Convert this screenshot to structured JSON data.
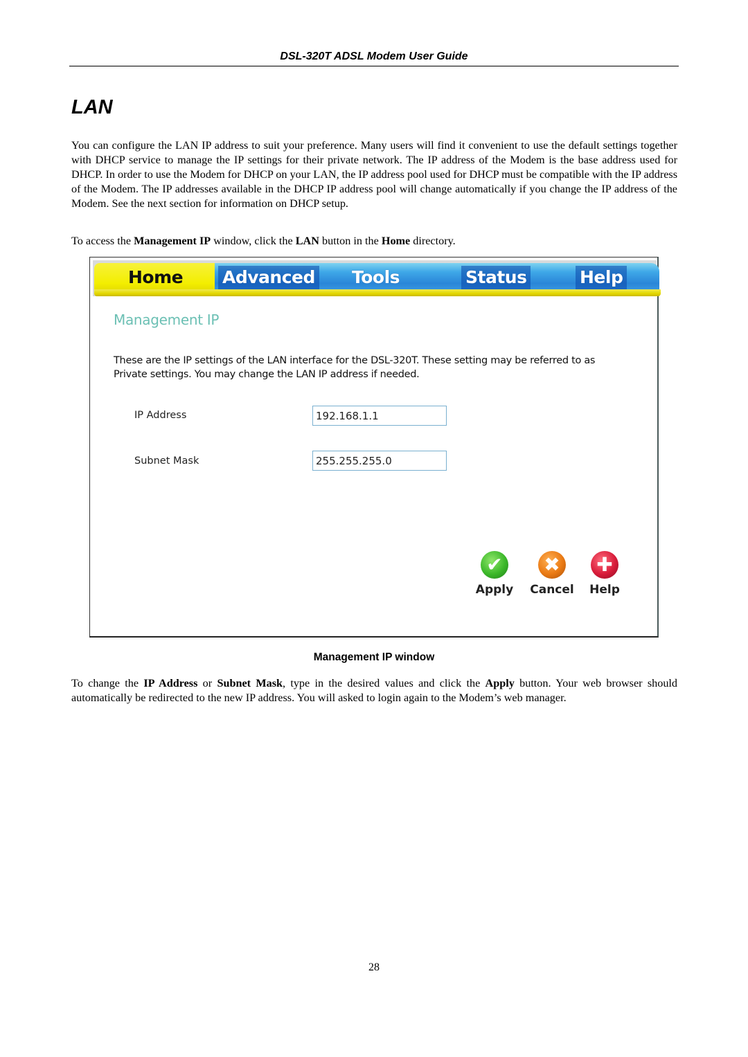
{
  "header": {
    "running_title": "DSL-320T ADSL Modem User Guide"
  },
  "section": {
    "title": "LAN"
  },
  "paragraphs": {
    "intro": "You can configure the LAN IP address to suit your preference. Many users will find it convenient to use the default settings together with DHCP service to manage the IP settings for their private network. The IP address of the Modem is the base address used for DHCP. In order to use the Modem for DHCP on your LAN, the IP address pool used for DHCP must be compatible with the IP address of the Modem. The IP addresses available in the DHCP IP address pool will change automatically if you change the IP address of the Modem. See the next section for information on DHCP setup.",
    "access": {
      "t1": "To access the ",
      "b1": "Management IP",
      "t2": " window, click the ",
      "b2": "LAN",
      "t3": " button in the ",
      "b3": "Home",
      "t4": " directory."
    },
    "change": {
      "t1": "To change the ",
      "b1": "IP Address",
      "t2": " or ",
      "b2": "Subnet Mask",
      "t3": ", type in the desired values and click the ",
      "b3": "Apply",
      "t4": " button. Your web browser should automatically be redirected to the new IP address. You will asked to login again to the Modem’s web manager."
    }
  },
  "screenshot": {
    "tabs": [
      {
        "label": "Home",
        "active": true
      },
      {
        "label": "Advanced",
        "active": false
      },
      {
        "label": "Tools",
        "active": false
      },
      {
        "label": "Status",
        "active": false
      },
      {
        "label": "Help",
        "active": false
      }
    ],
    "panel_title": "Management IP",
    "description": "These are the IP settings of the LAN interface for the DSL-320T. These setting may be referred to as Private settings. You may change the LAN IP address if needed.",
    "fields": {
      "ip_address": {
        "label": "IP Address",
        "value": "192.168.1.1"
      },
      "subnet_mask": {
        "label": "Subnet Mask",
        "value": "255.255.255.0"
      }
    },
    "actions": [
      {
        "label": "Apply",
        "icon": "check-icon",
        "glyph": "✔",
        "color": "#3cb82a"
      },
      {
        "label": "Cancel",
        "icon": "x-icon",
        "glyph": "✖",
        "color": "#ea7a14"
      },
      {
        "label": "Help",
        "icon": "plus-icon",
        "glyph": "✚",
        "color": "#d81c3a"
      }
    ],
    "colors": {
      "active_tab": "#f3ee00",
      "inactive_tab": "#2a86d8",
      "panel_title": "#6cc0b4"
    }
  },
  "caption": "Management IP window",
  "page_number": "28"
}
